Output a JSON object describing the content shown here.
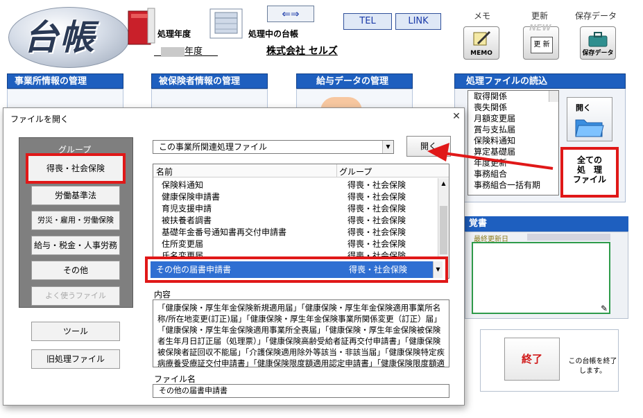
{
  "app": {
    "logo_text": "台帳",
    "label_year": "処理年度",
    "label_ledger": "処理中の台帳",
    "year_value": "年度",
    "company": "株式会社 セルズ",
    "arrows": "⇐⇒",
    "tel": "TEL",
    "link": "LINK",
    "captions": {
      "memo": "メモ",
      "update": "更新",
      "save": "保存データ"
    },
    "memo_btn": "MEMO",
    "update_btn": "更 新",
    "update_new": "NEW",
    "save_btn": "保存データ",
    "sections": {
      "office": "事業所情報の管理",
      "insured": "被保険者情報の管理",
      "salary": "給与データの管理"
    },
    "file_panel_title": "処理ファイルの読込",
    "file_list": [
      "取得関係",
      "喪失関係",
      "月額変更届",
      "賞与支払届",
      "保険料通知",
      "算定基礎届",
      "年度更新",
      "事務組合",
      "事務組合一括有期"
    ],
    "open_icon_label": "開く",
    "all_files_lines": [
      "全ての",
      "処　理",
      "ファイル"
    ],
    "memo_title": "覚書",
    "memo_caption": "最終更新日",
    "end_label": "終了",
    "end_desc": "この台帳を終了します。"
  },
  "dialog": {
    "title": "ファイルを開く",
    "close": "✕",
    "group_label": "グループ",
    "groups": [
      "得喪・社会保険",
      "労働基準法",
      "労災・雇用・労働保険",
      "給与・税金・人事労務",
      "その他",
      "よく使うファイル"
    ],
    "tool": "ツール",
    "old_files": "旧処理ファイル",
    "combo_value": "この事業所関連処理ファイル",
    "open": "開く",
    "columns": {
      "name": "名前",
      "group": "グループ"
    },
    "rows": [
      {
        "name": "保険料通知",
        "group": "得喪・社会保険"
      },
      {
        "name": "健康保険申請書",
        "group": "得喪・社会保険"
      },
      {
        "name": "育児支援申請",
        "group": "得喪・社会保険"
      },
      {
        "name": "被扶養者調書",
        "group": "得喪・社会保険"
      },
      {
        "name": "基礎年金番号通知書再交付申請書",
        "group": "得喪・社会保険"
      },
      {
        "name": "住所変更届",
        "group": "得喪・社会保険"
      },
      {
        "name": "氏名変更届",
        "group": "得喪・社会保険"
      }
    ],
    "selected": {
      "name": "その他の届書申請書",
      "group": "得喪・社会保険"
    },
    "content_label": "内容",
    "content": "「健康保険・厚生年金保険新規適用届」「健康保険・厚生年金保険適用事業所名称/所在地変更(訂正)届」「健康保険・厚生年金保険事業所関係変更（訂正）届」「健康保険・厚生年金保険適用事業所全喪届」「健康保険・厚生年金保険被保険者生年月日訂正届（処理票）」「健康保険高齢受給者証再交付申請書」「健康保険被保険者証回収不能届」「介護保険適用除外等該当・非該当届」「健康保険特定疾病療養受療証交付申請書」「健康保険限度額適用認定申請書」「健康保険限度額適用・標準負担額減額認定申請書」「健康保険・厚生年金保険特定適用事業所該当届」",
    "filename_label": "ファイル名",
    "filename_value": "その他の届書申請書"
  }
}
